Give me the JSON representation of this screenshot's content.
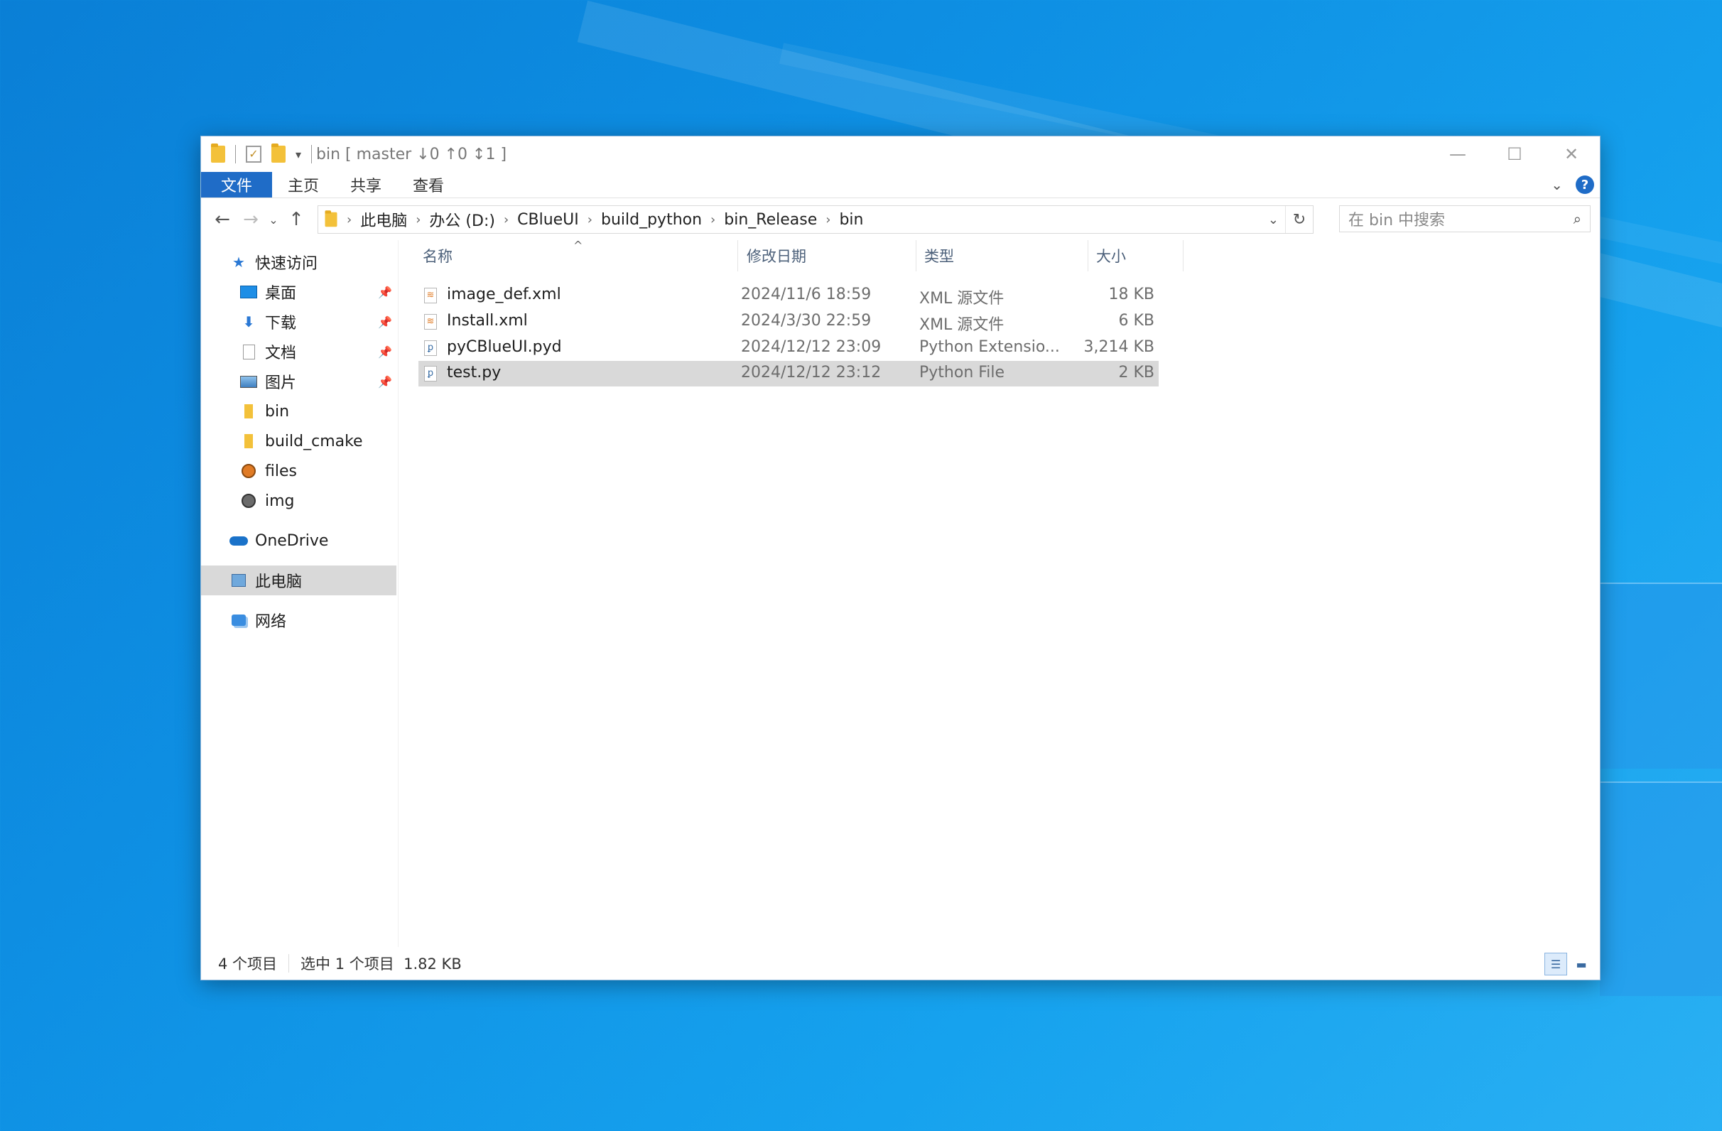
{
  "window": {
    "title": "bin [ master ↓0 ↑0 ↕1 ]",
    "controls": {
      "minimize": "—",
      "maximize": "☐",
      "close": "✕"
    }
  },
  "ribbon": {
    "tabs": [
      "文件",
      "主页",
      "共享",
      "查看"
    ],
    "help": "?"
  },
  "address": {
    "crumbs": [
      "此电脑",
      "办公 (D:)",
      "CBlueUI",
      "build_python",
      "bin_Release",
      "bin"
    ]
  },
  "search": {
    "placeholder": "在 bin 中搜索"
  },
  "sidebar": {
    "quick_access": "快速访问",
    "items": [
      {
        "label": "桌面",
        "icon": "desktop-icon",
        "pinned": true
      },
      {
        "label": "下载",
        "icon": "download-icon",
        "pinned": true
      },
      {
        "label": "文档",
        "icon": "document-icon",
        "pinned": true
      },
      {
        "label": "图片",
        "icon": "picture-icon",
        "pinned": true
      },
      {
        "label": "bin",
        "icon": "folder-icon",
        "pinned": false
      },
      {
        "label": "build_cmake",
        "icon": "folder-icon",
        "pinned": false
      },
      {
        "label": "files",
        "icon": "git-folder-icon",
        "pinned": false
      },
      {
        "label": "img",
        "icon": "git-folder-icon",
        "pinned": false
      }
    ],
    "onedrive": "OneDrive",
    "this_pc": "此电脑",
    "network": "网络"
  },
  "columns": {
    "name": "名称",
    "date": "修改日期",
    "type": "类型",
    "size": "大小"
  },
  "files": [
    {
      "name": "image_def.xml",
      "date": "2024/11/6 18:59",
      "type": "XML 源文件",
      "size": "18 KB",
      "icon": "xml-icon"
    },
    {
      "name": "Install.xml",
      "date": "2024/3/30 22:59",
      "type": "XML 源文件",
      "size": "6 KB",
      "icon": "xml-icon"
    },
    {
      "name": "pyCBlueUI.pyd",
      "date": "2024/12/12 23:09",
      "type": "Python Extensio...",
      "size": "3,214 KB",
      "icon": "python-icon"
    },
    {
      "name": "test.py",
      "date": "2024/12/12 23:12",
      "type": "Python File",
      "size": "2 KB",
      "icon": "python-icon",
      "selected": true
    }
  ],
  "status": {
    "count": "4 个项目",
    "selection": "选中 1 个项目  1.82 KB"
  }
}
